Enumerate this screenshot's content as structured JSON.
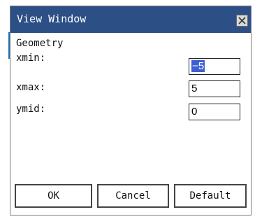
{
  "window": {
    "title": "View Window",
    "close_icon": "close-icon"
  },
  "content": {
    "section_title": "Geometry",
    "fields": [
      {
        "label": "xmin:",
        "value": "−5",
        "selected": true
      },
      {
        "label": "xmax:",
        "value": "5",
        "selected": false
      },
      {
        "label": "ymid:",
        "value": "0",
        "selected": false
      }
    ]
  },
  "buttons": {
    "ok": "OK",
    "cancel": "Cancel",
    "default": "Default"
  },
  "colors": {
    "titlebar": "#2c4f86",
    "selection": "#3c5fd4"
  }
}
